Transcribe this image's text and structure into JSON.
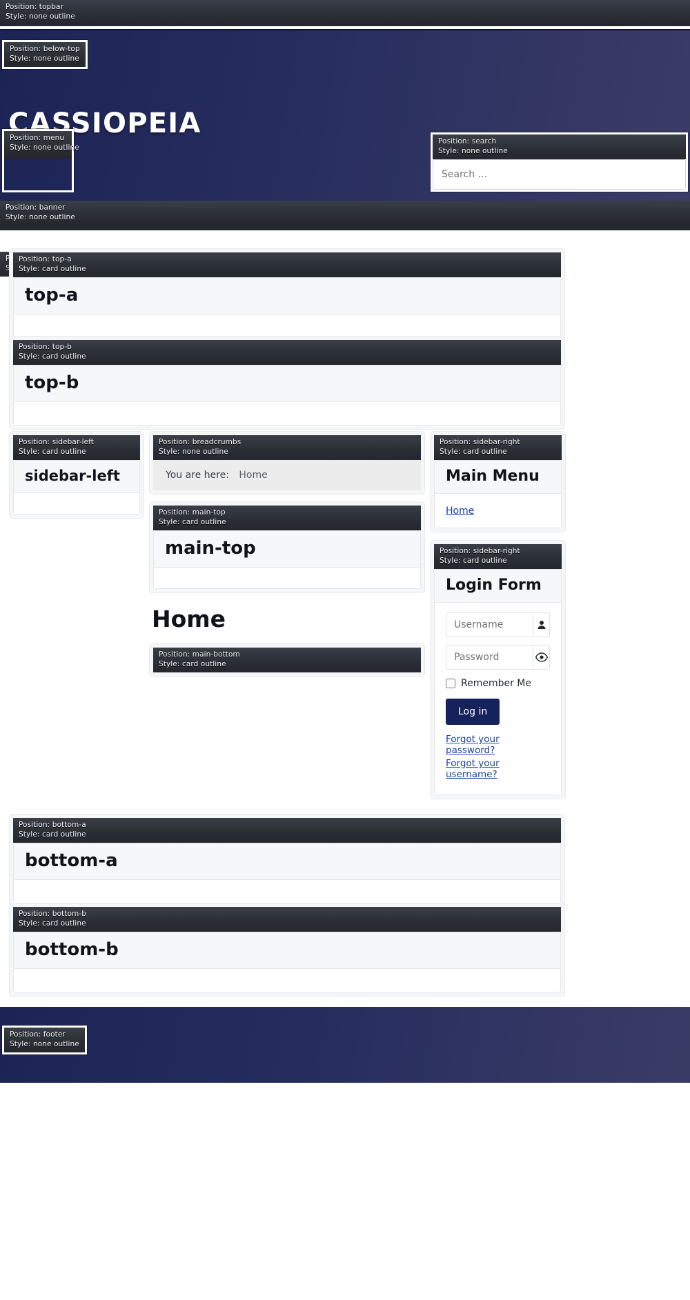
{
  "site": {
    "brand": "CASSIOPEIA",
    "page_heading": "Home"
  },
  "labels": {
    "position_key": "Position:",
    "style_key": "Style:",
    "topbar": {
      "position": "Position: topbar",
      "style": "Style: none outline"
    },
    "below_top": {
      "position": "Position: below-top",
      "style": "Style: none outline"
    },
    "menu": {
      "position": "Position: menu",
      "style": "Style: none outline"
    },
    "search": {
      "position": "Position: search",
      "style": "Style: none outline"
    },
    "banner": {
      "position": "Position: banner",
      "style": "Style: none outline"
    },
    "top_a": {
      "position": "Position: top-a",
      "style": "Style: card outline"
    },
    "top_b": {
      "position": "Position: top-b",
      "style": "Style: card outline"
    },
    "sidebar_left": {
      "position": "Position: sidebar-left",
      "style": "Style: card outline"
    },
    "breadcrumbs": {
      "position": "Position: breadcrumbs",
      "style": "Style: none outline"
    },
    "main_top": {
      "position": "Position: main-top",
      "style": "Style: card outline"
    },
    "main_bottom": {
      "position": "Position: main-bottom",
      "style": "Style: card outline"
    },
    "sidebar_right_menu": {
      "position": "Position: sidebar-right",
      "style": "Style: card outline"
    },
    "sidebar_right_login": {
      "position": "Position: sidebar-right",
      "style": "Style: card outline"
    },
    "bottom_a": {
      "position": "Position: bottom-a",
      "style": "Style: card outline"
    },
    "bottom_b": {
      "position": "Position: bottom-b",
      "style": "Style: card outline"
    },
    "footer": {
      "position": "Position: footer",
      "style": "Style: none outline"
    },
    "hidden_behind_top_a": {
      "position": "Position:",
      "style": "Style:"
    }
  },
  "search": {
    "placeholder": "Search ...",
    "value": ""
  },
  "breadcrumbs": {
    "prefix": "You are here:",
    "items": [
      "Home"
    ]
  },
  "cards": {
    "top_a": "top-a",
    "top_b": "top-b",
    "sidebar_left": "sidebar-left",
    "main_top": "main-top",
    "bottom_a": "bottom-a",
    "bottom_b": "bottom-b"
  },
  "main_menu": {
    "title": "Main Menu",
    "items": [
      {
        "label": "Home",
        "href": "#"
      }
    ]
  },
  "login_form": {
    "title": "Login Form",
    "username_placeholder": "Username",
    "password_placeholder": "Password",
    "username_icon": "user-icon",
    "password_icon": "eye-icon",
    "remember_label": "Remember Me",
    "remember_checked": false,
    "submit_label": "Log in",
    "forgot_password": "Forgot your password?",
    "forgot_username": "Forgot your username?"
  },
  "colors": {
    "header_blue_dark": "#1c2456",
    "header_blue_light": "#3b3c66",
    "label_dark": "#2b2f36",
    "link_blue": "#1a3ea8",
    "button_navy": "#15225c",
    "card_head_grey": "#f6f7f8",
    "breadcrumb_grey": "#ececec"
  }
}
